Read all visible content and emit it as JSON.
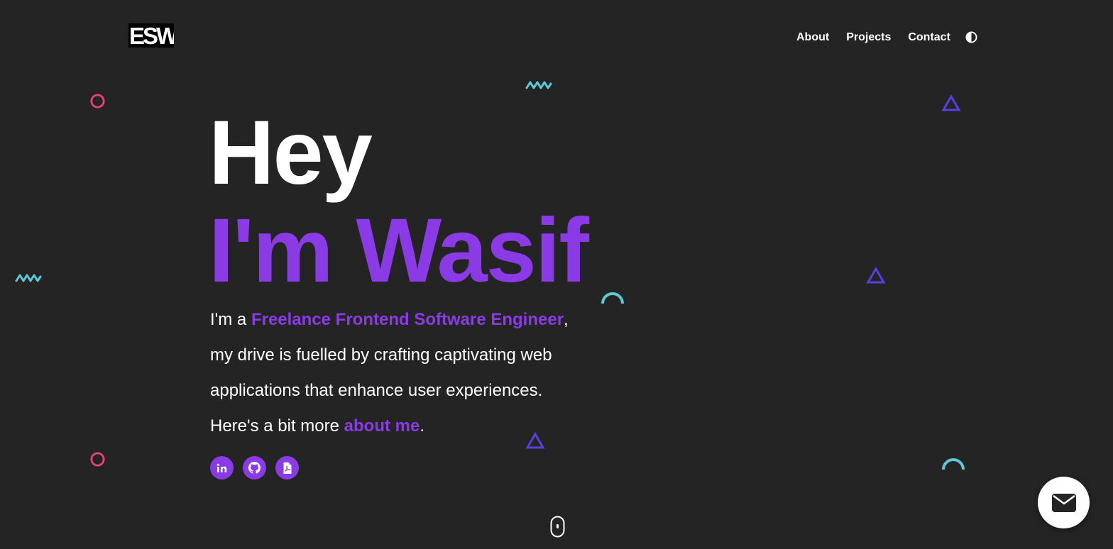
{
  "header": {
    "logo_text": "ESW",
    "nav": [
      {
        "label": "About"
      },
      {
        "label": "Projects"
      },
      {
        "label": "Contact"
      }
    ],
    "theme_toggle_icon": "half-circle-contrast-icon"
  },
  "hero": {
    "greeting": "Hey",
    "name": "I'm Wasif",
    "intro_prefix": "I'm a ",
    "role": "Freelance Frontend Software Engineer",
    "intro_comma": ",",
    "line2": "my drive is fuelled by crafting captivating web",
    "line3": "applications that enhance user experiences.",
    "line4_prefix": "Here's a bit more ",
    "about_link": "about me",
    "line4_suffix": "."
  },
  "socials": [
    {
      "icon": "linkedin-icon",
      "label": "in"
    },
    {
      "icon": "github-icon"
    },
    {
      "icon": "pdf-resume-icon"
    }
  ],
  "colors": {
    "background": "#242424",
    "accent_purple": "#8a3be6",
    "pink": "#e8407f",
    "cyan": "#5ec8d6",
    "indigo": "#5a3fe0",
    "text": "#ffffff"
  },
  "scroll_indicator_icon": "mouse-scroll-icon",
  "mail_button_icon": "envelope-icon"
}
